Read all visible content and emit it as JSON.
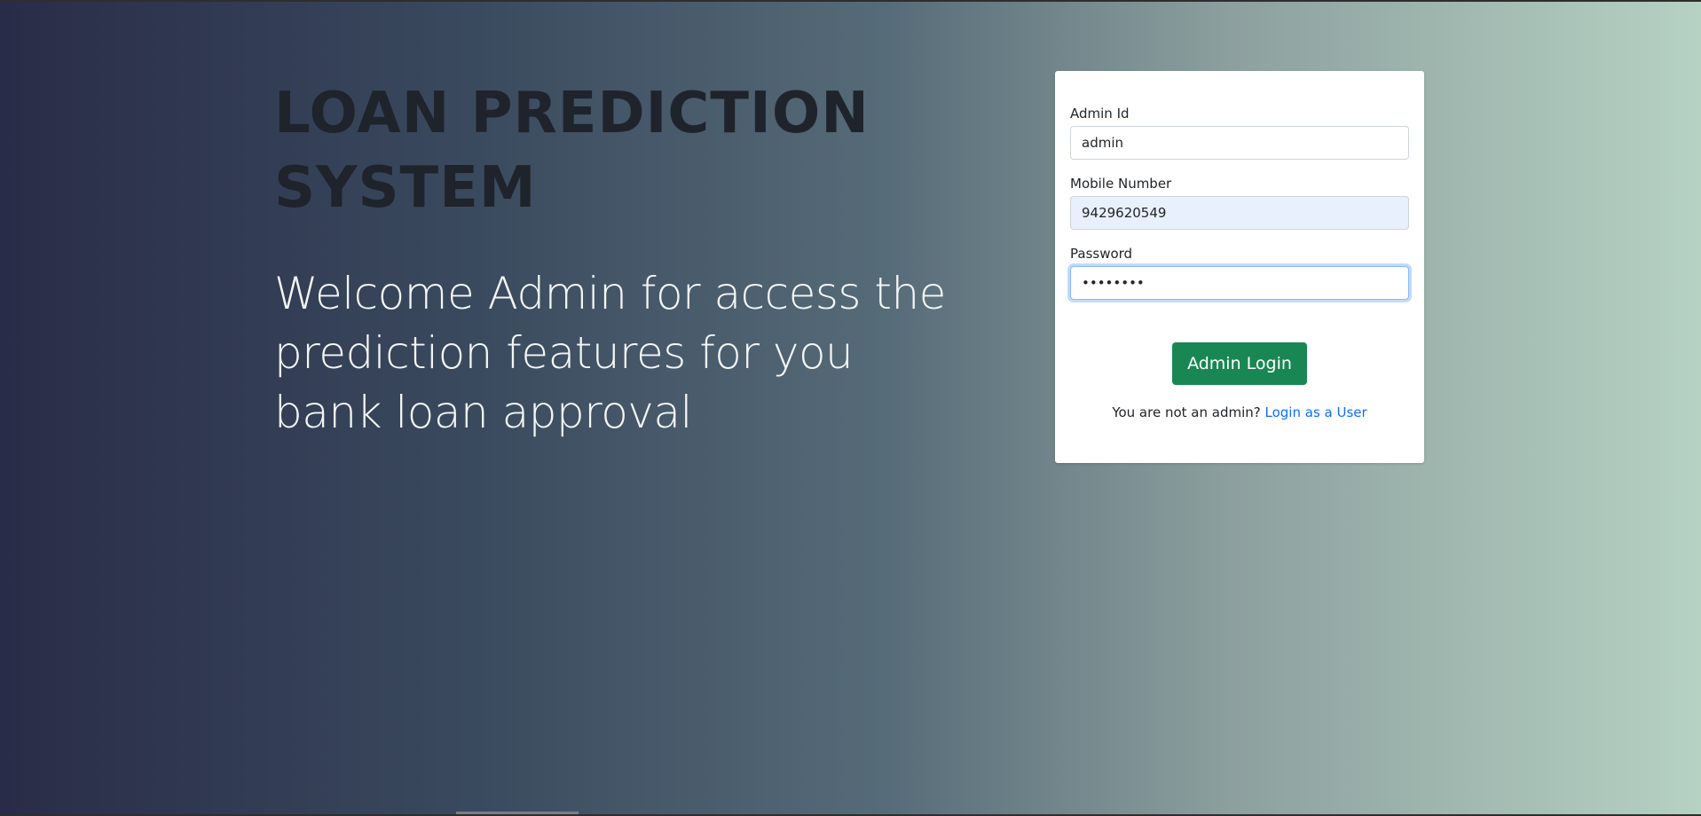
{
  "hero": {
    "title": "LOAN PREDICTION SYSTEM",
    "subtitle": "Welcome Admin for access the prediction features for you bank loan approval"
  },
  "login_form": {
    "admin_id": {
      "label": "Admin Id",
      "value": "admin"
    },
    "mobile": {
      "label": "Mobile Number",
      "value": "9429620549"
    },
    "password": {
      "label": "Password",
      "value": "••••••••"
    },
    "submit_label": "Admin Login",
    "switch_prompt": "You are not an admin?",
    "switch_link": "Login as a User"
  },
  "colors": {
    "background_gradient": [
      "#292c48",
      "#3a4a5e",
      "#566b78",
      "#8c9f9e",
      "#b6d2c3"
    ],
    "title": "#1f232b",
    "subtitle": "#f4f6f6",
    "primary_button": "#198754",
    "link": "#0d6efd",
    "autofill": "#e8f0fe"
  }
}
